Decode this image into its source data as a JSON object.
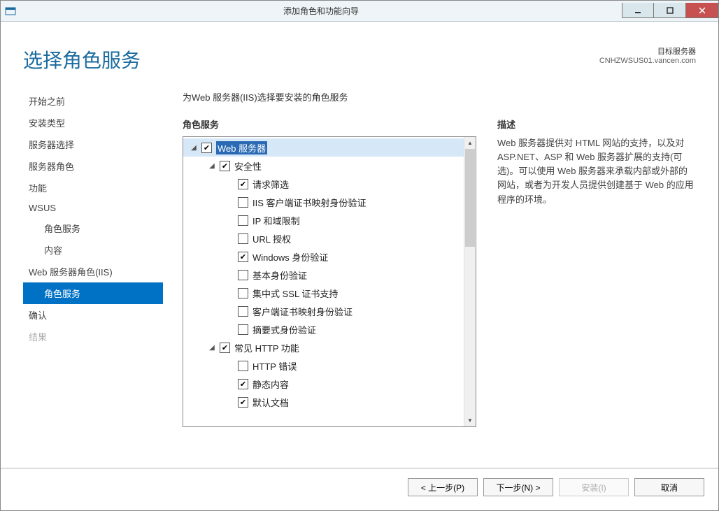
{
  "window": {
    "title": "添加角色和功能向导"
  },
  "header": {
    "title": "选择角色服务",
    "target_label": "目标服务器",
    "target_server": "CNHZWSUS01.vancen.com"
  },
  "sidebar": {
    "steps": [
      {
        "label": "开始之前",
        "sub": false
      },
      {
        "label": "安装类型",
        "sub": false
      },
      {
        "label": "服务器选择",
        "sub": false
      },
      {
        "label": "服务器角色",
        "sub": false
      },
      {
        "label": "功能",
        "sub": false
      },
      {
        "label": "WSUS",
        "sub": false
      },
      {
        "label": "角色服务",
        "sub": true
      },
      {
        "label": "内容",
        "sub": true
      },
      {
        "label": "Web 服务器角色(IIS)",
        "sub": false
      },
      {
        "label": "角色服务",
        "sub": true,
        "selected": true
      },
      {
        "label": "确认",
        "sub": false
      },
      {
        "label": "结果",
        "sub": false,
        "disabled": true
      }
    ]
  },
  "main": {
    "instruction": "为Web 服务器(IIS)选择要安装的角色服务",
    "roles_label": "角色服务",
    "desc_label": "描述",
    "description": "Web 服务器提供对 HTML 网站的支持，以及对 ASP.NET、ASP 和 Web 服务器扩展的支持(可选)。可以使用 Web 服务器来承载内部或外部的网站，或者为开发人员提供创建基于 Web 的应用程序的环境。"
  },
  "tree": [
    {
      "depth": 0,
      "expander": "open",
      "checked": true,
      "label": "Web 服务器",
      "highlight": true
    },
    {
      "depth": 1,
      "expander": "open",
      "checked": true,
      "label": "安全性"
    },
    {
      "depth": 2,
      "expander": "none",
      "checked": true,
      "label": "请求筛选"
    },
    {
      "depth": 2,
      "expander": "none",
      "checked": false,
      "label": "IIS 客户端证书映射身份验证"
    },
    {
      "depth": 2,
      "expander": "none",
      "checked": false,
      "label": "IP 和域限制"
    },
    {
      "depth": 2,
      "expander": "none",
      "checked": false,
      "label": "URL 授权"
    },
    {
      "depth": 2,
      "expander": "none",
      "checked": true,
      "label": "Windows 身份验证"
    },
    {
      "depth": 2,
      "expander": "none",
      "checked": false,
      "label": "基本身份验证"
    },
    {
      "depth": 2,
      "expander": "none",
      "checked": false,
      "label": "集中式 SSL 证书支持"
    },
    {
      "depth": 2,
      "expander": "none",
      "checked": false,
      "label": "客户端证书映射身份验证"
    },
    {
      "depth": 2,
      "expander": "none",
      "checked": false,
      "label": "摘要式身份验证"
    },
    {
      "depth": 1,
      "expander": "open",
      "checked": true,
      "label": "常见 HTTP 功能"
    },
    {
      "depth": 2,
      "expander": "none",
      "checked": false,
      "label": "HTTP 错误"
    },
    {
      "depth": 2,
      "expander": "none",
      "checked": true,
      "label": "静态内容"
    },
    {
      "depth": 2,
      "expander": "none",
      "checked": true,
      "label": "默认文档"
    }
  ],
  "footer": {
    "prev": "< 上一步(P)",
    "next": "下一步(N) >",
    "install": "安装(I)",
    "cancel": "取消"
  }
}
